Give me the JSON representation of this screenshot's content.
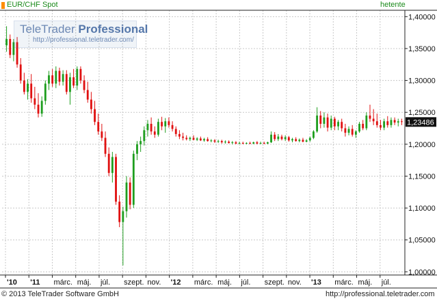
{
  "header": {
    "instrument": "EUR/CHF Spot",
    "period": "hetente"
  },
  "watermark": {
    "brand_regular": "TeleTrader",
    "brand_bold": "Professional",
    "url": "http://professional.teletrader.com/"
  },
  "footer": {
    "copyright": "© 2013 TeleTrader Software GmbH",
    "url": "http://professional.teletrader.com"
  },
  "colors": {
    "up": "#1e9e1e",
    "down": "#e01010",
    "grid": "#c8c8c8",
    "header_text": "#1a8a1a",
    "price_tag_bg": "#111111"
  },
  "chart_data": {
    "type": "candlestick",
    "title": "EUR/CHF Spot",
    "interval": "hetente",
    "ylim": [
      0.995,
      1.41
    ],
    "y_ticks": [
      "1,00000",
      "1,05000",
      "1,10000",
      "1,15000",
      "1,20000",
      "1,25000",
      "1,30000",
      "1,35000",
      "1,40000"
    ],
    "x_labels": [
      "'10",
      "'11",
      "márc.",
      "máj.",
      "júl.",
      "szept.",
      "nov.",
      "'12",
      "márc.",
      "máj.",
      "júl.",
      "szept.",
      "nov.",
      "'13",
      "márc.",
      "máj.",
      "júl."
    ],
    "last_price": "1,23486",
    "grid": true,
    "candles": [
      [
        1.355,
        1.385,
        1.345,
        1.365
      ],
      [
        1.365,
        1.372,
        1.335,
        1.34
      ],
      [
        1.34,
        1.365,
        1.33,
        1.36
      ],
      [
        1.36,
        1.368,
        1.32,
        1.325
      ],
      [
        1.325,
        1.335,
        1.295,
        1.3
      ],
      [
        1.3,
        1.312,
        1.278,
        1.282
      ],
      [
        1.282,
        1.302,
        1.27,
        1.295
      ],
      [
        1.295,
        1.31,
        1.265,
        1.272
      ],
      [
        1.272,
        1.29,
        1.255,
        1.262
      ],
      [
        1.262,
        1.28,
        1.242,
        1.248
      ],
      [
        1.248,
        1.275,
        1.243,
        1.268
      ],
      [
        1.268,
        1.3,
        1.262,
        1.295
      ],
      [
        1.295,
        1.315,
        1.285,
        1.308
      ],
      [
        1.308,
        1.318,
        1.29,
        1.295
      ],
      [
        1.295,
        1.322,
        1.288,
        1.315
      ],
      [
        1.315,
        1.32,
        1.292,
        1.298
      ],
      [
        1.298,
        1.316,
        1.292,
        1.31
      ],
      [
        1.31,
        1.316,
        1.278,
        1.282
      ],
      [
        1.282,
        1.312,
        1.262,
        1.305
      ],
      [
        1.305,
        1.318,
        1.288,
        1.292
      ],
      [
        1.292,
        1.322,
        1.285,
        1.318
      ],
      [
        1.318,
        1.322,
        1.295,
        1.3
      ],
      [
        1.3,
        1.308,
        1.28,
        1.285
      ],
      [
        1.285,
        1.298,
        1.265,
        1.27
      ],
      [
        1.27,
        1.282,
        1.248,
        1.255
      ],
      [
        1.255,
        1.268,
        1.23,
        1.235
      ],
      [
        1.235,
        1.248,
        1.215,
        1.22
      ],
      [
        1.22,
        1.232,
        1.205,
        1.21
      ],
      [
        1.21,
        1.22,
        1.18,
        1.185
      ],
      [
        1.185,
        1.195,
        1.15,
        1.155
      ],
      [
        1.155,
        1.188,
        1.14,
        1.18
      ],
      [
        1.18,
        1.185,
        1.105,
        1.11
      ],
      [
        1.11,
        1.12,
        1.07,
        1.078
      ],
      [
        1.078,
        1.102,
        1.01,
        1.095
      ],
      [
        1.095,
        1.15,
        1.085,
        1.14
      ],
      [
        1.14,
        1.148,
        1.098,
        1.105
      ],
      [
        1.105,
        1.19,
        1.1,
        1.185
      ],
      [
        1.185,
        1.205,
        1.175,
        1.2
      ],
      [
        1.2,
        1.212,
        1.188,
        1.205
      ],
      [
        1.205,
        1.228,
        1.198,
        1.222
      ],
      [
        1.222,
        1.238,
        1.212,
        1.232
      ],
      [
        1.232,
        1.242,
        1.215,
        1.22
      ],
      [
        1.22,
        1.228,
        1.21,
        1.215
      ],
      [
        1.215,
        1.24,
        1.212,
        1.235
      ],
      [
        1.235,
        1.243,
        1.222,
        1.228
      ],
      [
        1.228,
        1.241,
        1.218,
        1.236
      ],
      [
        1.236,
        1.242,
        1.226,
        1.23
      ],
      [
        1.23,
        1.236,
        1.22,
        1.224
      ],
      [
        1.224,
        1.228,
        1.212,
        1.216
      ],
      [
        1.216,
        1.222,
        1.208,
        1.212
      ],
      [
        1.212,
        1.218,
        1.206,
        1.21
      ],
      [
        1.21,
        1.214,
        1.206,
        1.208
      ],
      [
        1.208,
        1.212,
        1.205,
        1.21
      ],
      [
        1.21,
        1.214,
        1.206,
        1.207
      ],
      [
        1.207,
        1.211,
        1.205,
        1.209
      ],
      [
        1.209,
        1.212,
        1.205,
        1.206
      ],
      [
        1.206,
        1.21,
        1.204,
        1.208
      ],
      [
        1.208,
        1.211,
        1.204,
        1.205
      ],
      [
        1.205,
        1.208,
        1.203,
        1.206
      ],
      [
        1.206,
        1.208,
        1.202,
        1.204
      ],
      [
        1.204,
        1.207,
        1.202,
        1.205
      ],
      [
        1.205,
        1.207,
        1.201,
        1.203
      ],
      [
        1.203,
        1.206,
        1.201,
        1.204
      ],
      [
        1.204,
        1.206,
        1.201,
        1.202
      ],
      [
        1.202,
        1.205,
        1.2,
        1.203
      ],
      [
        1.203,
        1.205,
        1.2,
        1.201
      ],
      [
        1.201,
        1.204,
        1.2,
        1.202
      ],
      [
        1.202,
        1.204,
        1.2,
        1.201
      ],
      [
        1.201,
        1.203,
        1.2,
        1.202
      ],
      [
        1.202,
        1.204,
        1.2,
        1.201
      ],
      [
        1.201,
        1.204,
        1.2,
        1.203
      ],
      [
        1.203,
        1.205,
        1.2,
        1.201
      ],
      [
        1.201,
        1.204,
        1.2,
        1.202
      ],
      [
        1.202,
        1.204,
        1.2,
        1.201
      ],
      [
        1.201,
        1.204,
        1.2,
        1.203
      ],
      [
        1.203,
        1.22,
        1.202,
        1.215
      ],
      [
        1.215,
        1.219,
        1.205,
        1.208
      ],
      [
        1.208,
        1.216,
        1.205,
        1.212
      ],
      [
        1.212,
        1.215,
        1.206,
        1.208
      ],
      [
        1.208,
        1.214,
        1.205,
        1.211
      ],
      [
        1.211,
        1.213,
        1.204,
        1.206
      ],
      [
        1.206,
        1.21,
        1.203,
        1.208
      ],
      [
        1.208,
        1.211,
        1.204,
        1.205
      ],
      [
        1.205,
        1.209,
        1.203,
        1.207
      ],
      [
        1.207,
        1.21,
        1.203,
        1.204
      ],
      [
        1.204,
        1.208,
        1.203,
        1.206
      ],
      [
        1.206,
        1.212,
        1.204,
        1.21
      ],
      [
        1.21,
        1.222,
        1.208,
        1.22
      ],
      [
        1.22,
        1.258,
        1.218,
        1.245
      ],
      [
        1.245,
        1.252,
        1.225,
        1.232
      ],
      [
        1.232,
        1.25,
        1.226,
        1.242
      ],
      [
        1.242,
        1.248,
        1.22,
        1.226
      ],
      [
        1.226,
        1.245,
        1.222,
        1.24
      ],
      [
        1.24,
        1.243,
        1.222,
        1.228
      ],
      [
        1.228,
        1.238,
        1.222,
        1.235
      ],
      [
        1.235,
        1.24,
        1.22,
        1.225
      ],
      [
        1.225,
        1.232,
        1.212,
        1.218
      ],
      [
        1.218,
        1.228,
        1.214,
        1.224
      ],
      [
        1.224,
        1.23,
        1.212,
        1.215
      ],
      [
        1.215,
        1.222,
        1.21,
        1.22
      ],
      [
        1.22,
        1.235,
        1.218,
        1.232
      ],
      [
        1.232,
        1.238,
        1.222,
        1.225
      ],
      [
        1.225,
        1.25,
        1.222,
        1.245
      ],
      [
        1.245,
        1.262,
        1.235,
        1.24
      ],
      [
        1.24,
        1.255,
        1.23,
        1.236
      ],
      [
        1.236,
        1.248,
        1.226,
        1.23
      ],
      [
        1.23,
        1.238,
        1.222,
        1.226
      ],
      [
        1.226,
        1.24,
        1.222,
        1.236
      ],
      [
        1.236,
        1.244,
        1.226,
        1.23
      ],
      [
        1.23,
        1.242,
        1.226,
        1.238
      ],
      [
        1.238,
        1.242,
        1.23,
        1.234
      ],
      [
        1.234,
        1.24,
        1.228,
        1.236
      ],
      [
        1.236,
        1.24,
        1.23,
        1.2349
      ]
    ]
  }
}
